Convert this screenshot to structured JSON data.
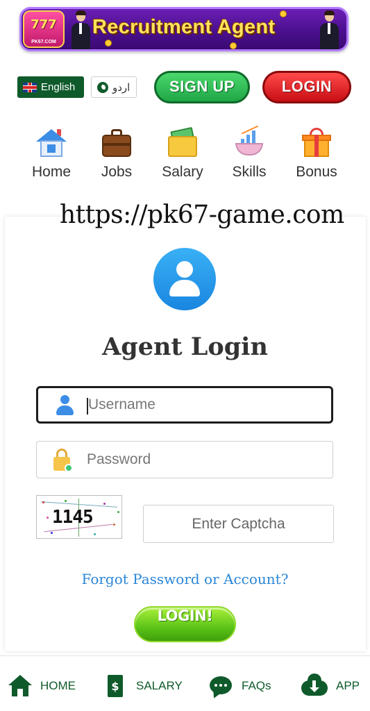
{
  "banner": {
    "logo_number": "777",
    "logo_site": "PK67.COM",
    "title": "Recruitment Agent"
  },
  "language": {
    "english_label": "English",
    "urdu_label": "اردو"
  },
  "header": {
    "signup_label": "SIGN UP",
    "login_label": "LOGIN"
  },
  "nav": {
    "items": [
      {
        "label": "Home",
        "icon": "home-icon"
      },
      {
        "label": "Jobs",
        "icon": "briefcase-icon"
      },
      {
        "label": "Salary",
        "icon": "money-envelope-icon"
      },
      {
        "label": "Skills",
        "icon": "chart-icon"
      },
      {
        "label": "Bonus",
        "icon": "gift-icon"
      }
    ]
  },
  "watermark_url": "https://pk67-game.com",
  "login_card": {
    "title": "Agent Login",
    "username_placeholder": "Username",
    "password_placeholder": "Password",
    "captcha_text": "1145",
    "captcha_placeholder": "Enter Captcha",
    "forgot_link": "Forgot Password or Account?",
    "submit_label": "LOGIN!"
  },
  "bottom_bar": {
    "items": [
      {
        "label": "HOME",
        "icon": "home-icon"
      },
      {
        "label": "SALARY",
        "icon": "salary-document-icon"
      },
      {
        "label": "FAQs",
        "icon": "chat-bubble-icon"
      },
      {
        "label": "APP",
        "icon": "cloud-download-icon"
      }
    ]
  },
  "colors": {
    "brand_green": "#0f5a2a",
    "signup_green": "#1fa646",
    "login_red": "#c80f14",
    "link_blue": "#2a86d8",
    "banner_purple": "#4b0f8f"
  }
}
